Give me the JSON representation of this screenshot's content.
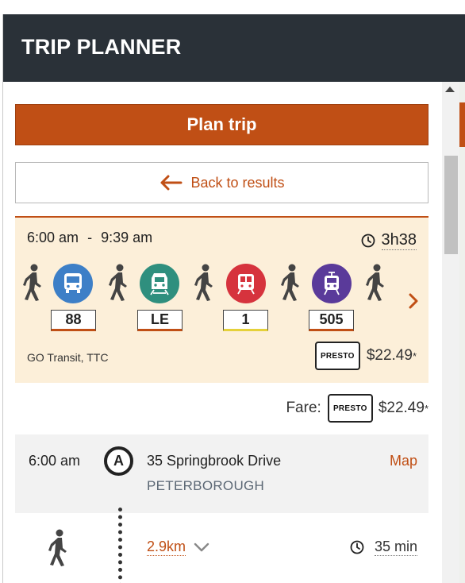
{
  "header": {
    "title": "TRIP PLANNER"
  },
  "actions": {
    "plan_trip": "Plan trip",
    "back_to_results": "Back to results"
  },
  "trip": {
    "depart": "6:00 am",
    "separator": "-",
    "arrive": "9:39 am",
    "duration": "3h38",
    "legs": [
      {
        "mode": "walk"
      },
      {
        "mode": "bus",
        "route": "88",
        "color": "#3d7fc7",
        "underline": "#c04f15"
      },
      {
        "mode": "walk"
      },
      {
        "mode": "train",
        "route": "LE",
        "color": "#2f8f7e",
        "underline": "#c04f15"
      },
      {
        "mode": "walk"
      },
      {
        "mode": "subway",
        "route": "1",
        "color": "#d6333d",
        "underline": "#e5d13a"
      },
      {
        "mode": "walk"
      },
      {
        "mode": "streetcar",
        "route": "505",
        "color": "#5a3a9a",
        "underline": "#c04f15"
      },
      {
        "mode": "walk"
      }
    ],
    "agencies": "GO Transit, TTC",
    "presto_label": "PRESTO",
    "fare": "$22.49",
    "fare_note": "*"
  },
  "fare_summary": {
    "label": "Fare:",
    "presto_label": "PRESTO",
    "amount": "$22.49",
    "note": "*"
  },
  "first_stop": {
    "time": "6:00 am",
    "marker": "A",
    "name": "35 Springbrook Drive",
    "city": "PETERBOROUGH",
    "map_link": "Map"
  },
  "walk_segment": {
    "distance": "2.9km",
    "duration": "35 min"
  },
  "colors": {
    "header_bg": "#2a3138",
    "accent": "#c04f15",
    "card_bg": "#fcefd9",
    "stop_bg": "#f2f2f2"
  }
}
